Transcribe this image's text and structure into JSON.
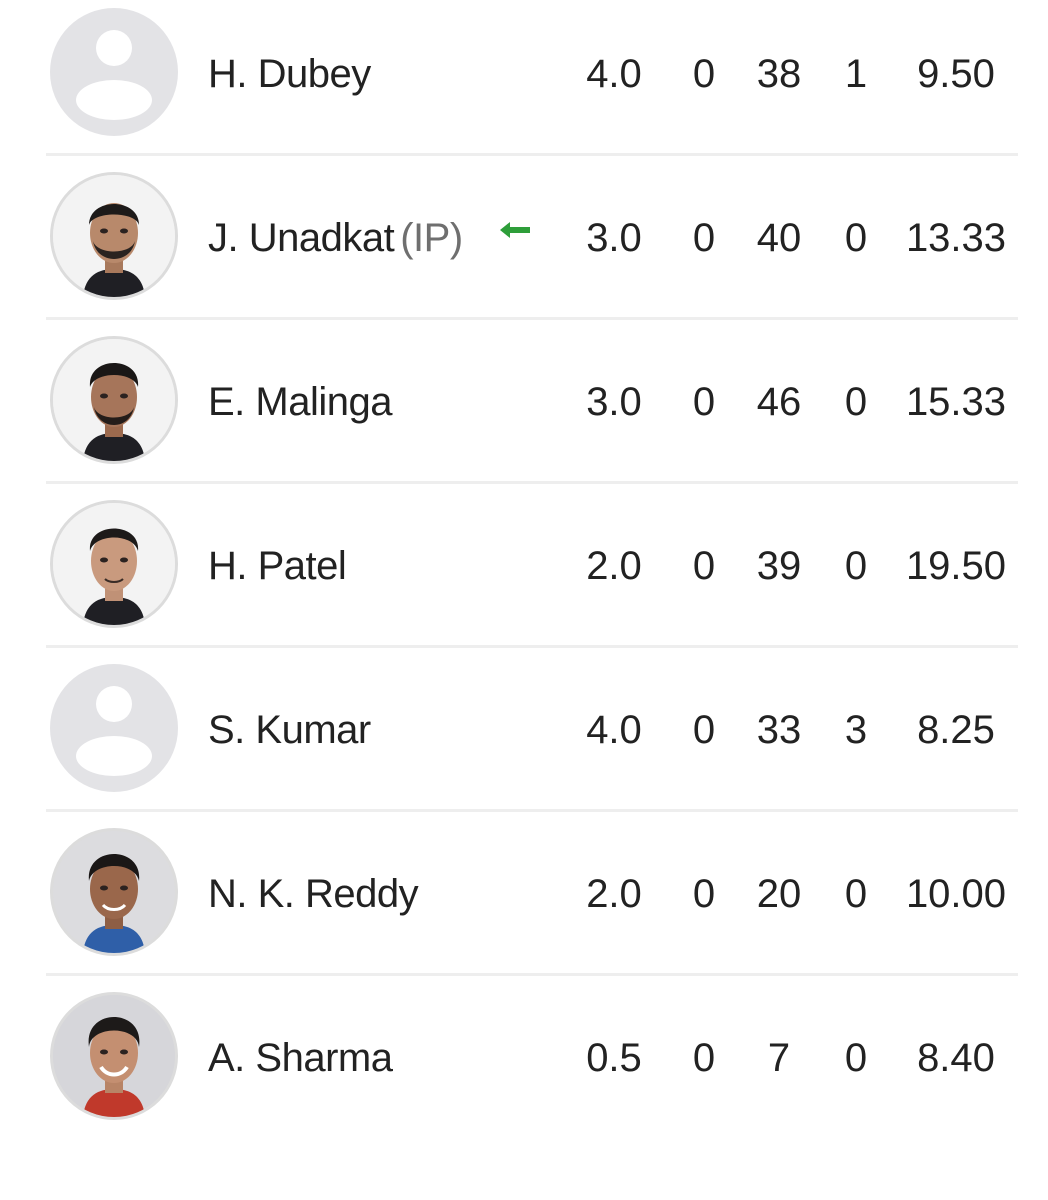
{
  "bowlers": [
    {
      "name": "H. Dubey",
      "tag": "",
      "overs": "4.0",
      "maidens": "0",
      "runs": "38",
      "wickets": "1",
      "economy": "9.50",
      "avatar": "placeholder-user-icon",
      "current": false
    },
    {
      "name": "J. Unadkat",
      "tag": "(IP)",
      "overs": "3.0",
      "maidens": "0",
      "runs": "40",
      "wickets": "0",
      "economy": "13.33",
      "avatar": "player-photo",
      "current": true
    },
    {
      "name": "E. Malinga",
      "tag": "",
      "overs": "3.0",
      "maidens": "0",
      "runs": "46",
      "wickets": "0",
      "economy": "15.33",
      "avatar": "player-photo",
      "current": false
    },
    {
      "name": "H. Patel",
      "tag": "",
      "overs": "2.0",
      "maidens": "0",
      "runs": "39",
      "wickets": "0",
      "economy": "19.50",
      "avatar": "player-photo",
      "current": false
    },
    {
      "name": "S. Kumar",
      "tag": "",
      "overs": "4.0",
      "maidens": "0",
      "runs": "33",
      "wickets": "3",
      "economy": "8.25",
      "avatar": "placeholder-user-icon",
      "current": false
    },
    {
      "name": "N. K. Reddy",
      "tag": "",
      "overs": "2.0",
      "maidens": "0",
      "runs": "20",
      "wickets": "0",
      "economy": "10.00",
      "avatar": "player-photo",
      "current": false
    },
    {
      "name": "A. Sharma",
      "tag": "",
      "overs": "0.5",
      "maidens": "0",
      "runs": "7",
      "wickets": "0",
      "economy": "8.40",
      "avatar": "player-photo",
      "current": false
    }
  ],
  "colors": {
    "text": "#222222",
    "muted": "#6f6f6f",
    "divider": "#eeeeee",
    "current_arrow": "#2e9e3a",
    "placeholder_bg": "#e3e3e6"
  },
  "icons": {
    "current_bowler": "left-arrow-icon",
    "no_photo": "placeholder-user-icon"
  }
}
